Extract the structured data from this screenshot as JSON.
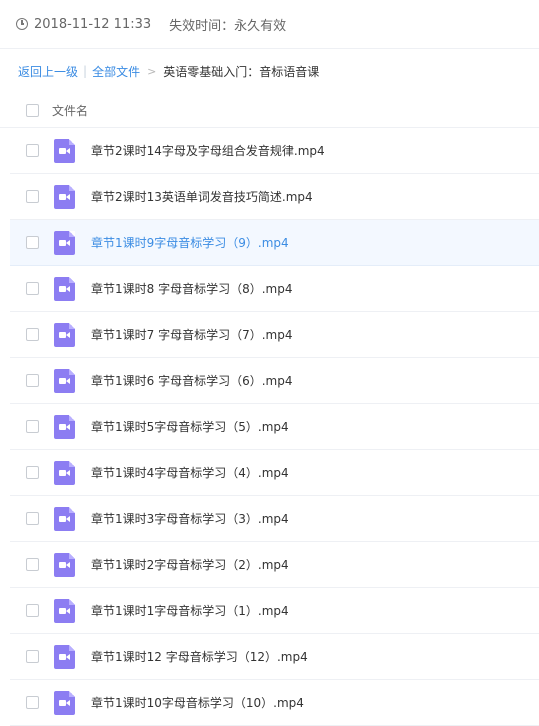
{
  "share": {
    "date": "2018-11-12 11:33",
    "expire": "失效时间：永久有效"
  },
  "breadcrumb": {
    "back": "返回上一级",
    "divider": "|",
    "all_files": "全部文件",
    "separator": ">",
    "current": "英语零基础入门：音标语音课"
  },
  "list": {
    "header": "文件名",
    "active_index": 2,
    "files": [
      "章节2课时14字母及字母组合发音规律.mp4",
      "章节2课时13英语单词发音技巧简述.mp4",
      "章节1课时9字母音标学习（9）.mp4",
      "章节1课时8 字母音标学习（8）.mp4",
      "章节1课时7 字母音标学习（7）.mp4",
      "章节1课时6 字母音标学习（6）.mp4",
      "章节1课时5字母音标学习（5）.mp4",
      "章节1课时4字母音标学习（4）.mp4",
      "章节1课时3字母音标学习（3）.mp4",
      "章节1课时2字母音标学习（2）.mp4",
      "章节1课时1字母音标学习（1）.mp4",
      "章节1课时12 字母音标学习（12）.mp4",
      "章节1课时10字母音标学习（10）.mp4"
    ]
  },
  "icons": {
    "clock": "clock-icon",
    "file": "video-file-icon",
    "accent": "#3b8ce3",
    "file_icon_color": "#8c7df2"
  }
}
